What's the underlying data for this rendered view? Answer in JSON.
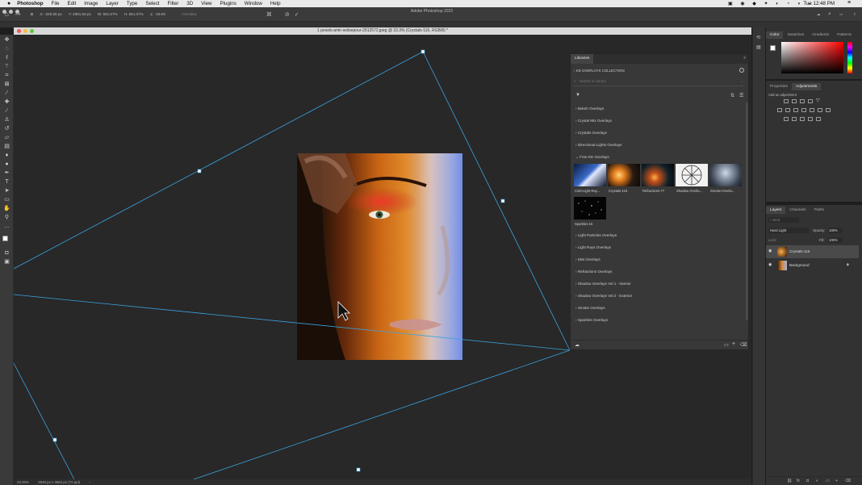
{
  "menubar": {
    "app": "Photoshop",
    "items": [
      "File",
      "Edit",
      "Image",
      "Layer",
      "Type",
      "Select",
      "Filter",
      "3D",
      "View",
      "Plugins",
      "Window",
      "Help"
    ],
    "center_title": "Adobe Photoshop 2022",
    "clock": "Tue 12:48 PM"
  },
  "options": {
    "x": "X: -328.59 px",
    "y": "Y: 2981.56 px",
    "w": "W: 561.07%",
    "h": "H: 561.07%",
    "angle": "-28.06",
    "interp": "Anti-alias"
  },
  "document": {
    "title": "1 pexels-amir-seilsepour-2912572.jpeg @ 33.3% (Crystals-116, RGB/8) *",
    "zoom": "33.33%",
    "info": "2848 px x 3662 px (72 ppi)"
  },
  "libraries": {
    "tab": "Libraries",
    "collection": "KD OVERLAYS COLLECTION",
    "search_placeholder": "Search in Library",
    "categories_before": [
      "Bokeh Overlays",
      "Crystal Mix Overlays",
      "Crystals Overlays",
      "Directional Lights Overlays"
    ],
    "expanded": "Free KD Overlays",
    "thumbs": [
      "Cold-Light-Ray...",
      "Crystals-116",
      "Refractions-77",
      "Shadow Overla...",
      "Smoke-Overla...",
      "Sparkles-15"
    ],
    "categories_after": [
      "Light Particles Overlays",
      "Light Rays Overlays",
      "Mist Overlays",
      "Refractions Overlays",
      "Shadow Overlays Vol 1 - Interior",
      "Shadow Overlays Vol 2 - Exterior",
      "Smoke Overlays",
      "Sparkles Overlays"
    ]
  },
  "color_panel": {
    "tabs": [
      "Color",
      "Swatches",
      "Gradients",
      "Patterns"
    ]
  },
  "adjust_panel": {
    "tabs": [
      "Properties",
      "Adjustments"
    ],
    "add_label": "Add an adjustment"
  },
  "layers_panel": {
    "tabs": [
      "Layers",
      "Channels",
      "Paths"
    ],
    "kind_placeholder": "Kind",
    "blend_mode": "Hard Light",
    "opacity_label": "Opacity:",
    "opacity_value": "100%",
    "lock_label": "Lock:",
    "fill_label": "Fill:",
    "fill_value": "100%",
    "layers": [
      "Crystals-116",
      "Background"
    ]
  },
  "colors": {
    "accent": "#2f9bd6",
    "transform_line": "#3aa3e0"
  }
}
